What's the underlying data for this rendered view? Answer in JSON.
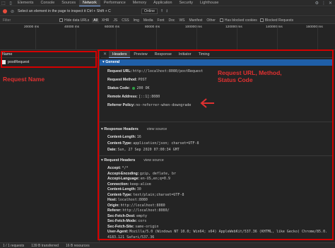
{
  "topbar": {
    "tabs": [
      "Elements",
      "Console",
      "Sources",
      "Network",
      "Performance",
      "Memory",
      "Application",
      "Security",
      "Lighthouse"
    ],
    "active_tab": "Network"
  },
  "toolbar": {
    "preserve_log": "Preserve log",
    "disable_cache": "Disable cache",
    "throttle": "Online"
  },
  "search_tooltip": "Select an element in the page to inspect it  Ctrl + Shift + C",
  "filterbar": {
    "placeholder": "Filter",
    "hide_data_urls": "Hide data URLs",
    "types": [
      "All",
      "XHR",
      "JS",
      "CSS",
      "Img",
      "Media",
      "Font",
      "Doc",
      "WS",
      "Manifest",
      "Other"
    ],
    "has_blocked_cookies": "Has blocked cookies",
    "blocked_requests": "Blocked Requests"
  },
  "timeline": {
    "ticks": [
      "20000 ms",
      "40000 ms",
      "60000 ms",
      "80000 ms",
      "100000 ms",
      "120000 ms",
      "140000 ms",
      "160000 ms"
    ]
  },
  "left": {
    "header": "Name",
    "rows": [
      "postRequest"
    ],
    "annotation": "Request Name"
  },
  "detail": {
    "tabs": [
      "Headers",
      "Preview",
      "Response",
      "Initiator",
      "Timing"
    ],
    "active_tab": "Headers",
    "general_title": "General",
    "general": [
      {
        "k": "Request URL:",
        "v": "http://localhost:8080/postRequest"
      },
      {
        "k": "Request Method:",
        "v": "POST"
      },
      {
        "k": "Status Code:",
        "v": "200 OK"
      },
      {
        "k": "Remote Address:",
        "v": "[::1]:8080"
      },
      {
        "k": "Referrer Policy:",
        "v": "no-referrer-when-downgrade"
      }
    ],
    "response_title": "Response Headers",
    "view_source": "view source",
    "response": [
      {
        "k": "Content-Length:",
        "v": "16"
      },
      {
        "k": "Content-Type:",
        "v": "application/json; charset=UTF-8"
      },
      {
        "k": "Date:",
        "v": "Sun, 27 Sep 2020 07:00:34 GMT"
      }
    ],
    "request_title": "Request Headers",
    "request": [
      {
        "k": "Accept:",
        "v": "*/*"
      },
      {
        "k": "Accept-Encoding:",
        "v": "gzip, deflate, br"
      },
      {
        "k": "Accept-Language:",
        "v": "en-US,en;q=0.9"
      },
      {
        "k": "Connection:",
        "v": "keep-alive"
      },
      {
        "k": "Content-Length:",
        "v": "30"
      },
      {
        "k": "Content-Type:",
        "v": "text/plain;charset=UTF-8"
      },
      {
        "k": "Host:",
        "v": "localhost:8080"
      },
      {
        "k": "Origin:",
        "v": "http://localhost:8080"
      },
      {
        "k": "Referer:",
        "v": "http://localhost:8080/"
      },
      {
        "k": "Sec-Fetch-Dest:",
        "v": "empty"
      },
      {
        "k": "Sec-Fetch-Mode:",
        "v": "cors"
      },
      {
        "k": "Sec-Fetch-Site:",
        "v": "same-origin"
      },
      {
        "k": "User-Agent:",
        "v": "Mozilla/5.0 (Windows NT 10.0; Win64; x64) AppleWebKit/537.36 (KHTML, like Gecko) Chrome/85.0."
      },
      {
        "k": "",
        "v": "4183.121 Safari/537.36"
      }
    ],
    "annotation": "Request URL, Method, Status Code"
  },
  "statusbar": {
    "requests": "1 / 1 requests",
    "transferred": "139 B transferred",
    "resources": "16 B resources"
  },
  "colors": {
    "accent": "#1f5fa8",
    "annotation": "#d40000",
    "record": "#e74c3c",
    "ok": "#2e9e44"
  }
}
